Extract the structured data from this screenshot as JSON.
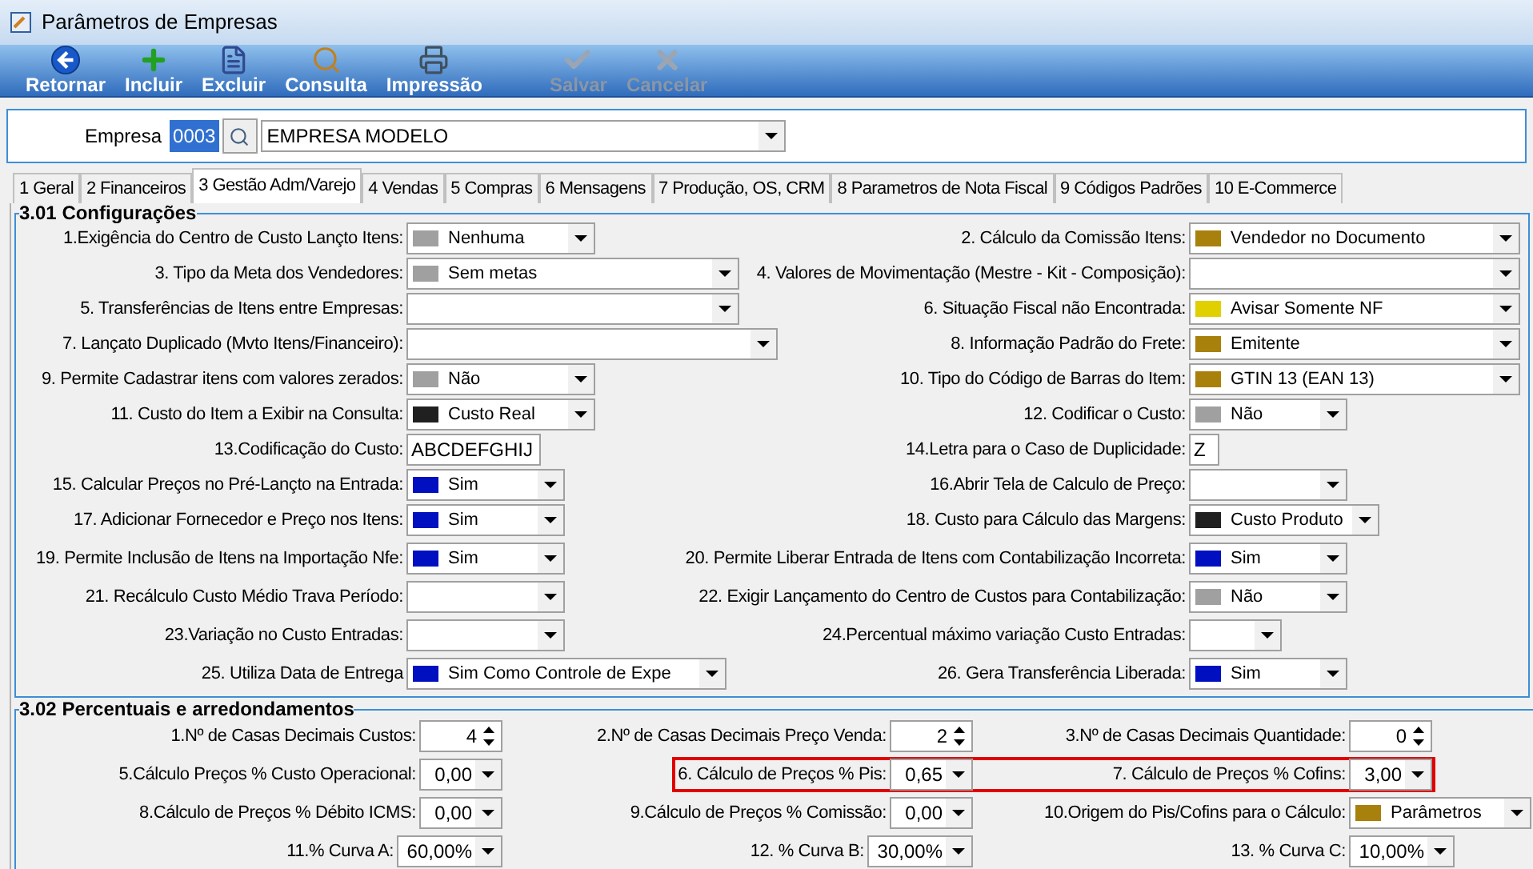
{
  "window": {
    "title": "Parâmetros de Empresas"
  },
  "toolbar": [
    {
      "kind": "back",
      "label": "Retornar",
      "disabled": false
    },
    {
      "kind": "add",
      "label": "Incluir",
      "disabled": false
    },
    {
      "kind": "delete",
      "label": "Excluir",
      "disabled": false
    },
    {
      "kind": "search",
      "label": "Consulta",
      "disabled": false
    },
    {
      "kind": "print",
      "label": "Impressão",
      "disabled": false
    },
    {
      "kind": "save",
      "label": "Salvar",
      "disabled": true
    },
    {
      "kind": "cancel",
      "label": "Cancelar",
      "disabled": true
    }
  ],
  "company": {
    "label": "Empresa",
    "code": "0003",
    "name": "EMPRESA MODELO"
  },
  "tabs": [
    {
      "label": "1 Geral",
      "selected": false
    },
    {
      "label": "2 Financeiros",
      "selected": false
    },
    {
      "label": "3 Gestão Adm/Varejo",
      "selected": true
    },
    {
      "label": "4 Vendas",
      "selected": false
    },
    {
      "label": "5 Compras",
      "selected": false
    },
    {
      "label": "6 Mensagens",
      "selected": false
    },
    {
      "label": "7 Produção, OS, CRM",
      "selected": false
    },
    {
      "label": "8 Parametros de Nota Fiscal",
      "selected": false
    },
    {
      "label": "9 Códigos Padrões",
      "selected": false
    },
    {
      "label": "10 E-Commerce",
      "selected": false
    }
  ],
  "config": {
    "title": "3.01 Configurações",
    "rows": [
      {
        "left": {
          "label": "1.Exigência do Centro de Custo Lançto Itens:",
          "kind": "select",
          "value": "Nenhuma",
          "color": "#a0a0a0"
        },
        "right": {
          "label": "2. Cálculo da Comissão Itens:",
          "kind": "select",
          "value": "Vendedor no Documento",
          "color": "#a8800c"
        }
      },
      {
        "left": {
          "label": "3. Tipo da Meta dos Vendedores:",
          "kind": "select",
          "value": "Sem metas",
          "color": "#a0a0a0"
        },
        "right": {
          "label": "4. Valores de Movimentação (Mestre - Kit - Composição):",
          "kind": "select"
        }
      },
      {
        "left": {
          "label": "5. Transferências  de Itens entre Empresas:",
          "kind": "select"
        },
        "right": {
          "label": "6. Situação Fiscal não Encontrada:",
          "kind": "select",
          "value": "Avisar Somente NF",
          "color": "#e0d000"
        }
      },
      {
        "left": {
          "label": "7. Lançato Duplicado (Mvto Itens/Financeiro):",
          "kind": "select"
        },
        "right": {
          "label": "8. Informação Padrão do Frete:",
          "kind": "select",
          "value": "Emitente",
          "color": "#a8800c"
        }
      },
      {
        "left": {
          "label": "9. Permite Cadastrar itens com valores zerados:",
          "kind": "select",
          "value": "Não",
          "color": "#a0a0a0"
        },
        "right": {
          "label": "10. Tipo do Código de Barras do Item:",
          "kind": "select",
          "value": "GTIN 13 (EAN 13)",
          "color": "#a8800c"
        }
      },
      {
        "left": {
          "label": "11. Custo do Item a Exibir na Consulta:",
          "kind": "select",
          "value": "Custo Real",
          "color": "#202020"
        },
        "right": {
          "label": "12. Codificar o Custo:",
          "kind": "select",
          "value": "Não",
          "color": "#a0a0a0"
        }
      },
      {
        "left": {
          "label": "13.Codificação do Custo:",
          "kind": "text",
          "value": "ABCDEFGHIJ"
        },
        "right": {
          "label": "14.Letra para o Caso de Duplicidade:",
          "kind": "text",
          "value": "Z"
        }
      },
      {
        "left": {
          "label": "15. Calcular Preços no Pré-Lançto na Entrada:",
          "kind": "select",
          "value": "Sim",
          "color": "#0010c0"
        },
        "right": {
          "label": "16.Abrir Tela de Calculo de Preço:",
          "kind": "select"
        }
      },
      {
        "left": {
          "label": "17. Adicionar Fornecedor e Preço nos Itens:",
          "kind": "select",
          "value": "Sim",
          "color": "#0010c0"
        },
        "right": {
          "label": "18. Custo para Cálculo das Margens:",
          "kind": "select",
          "value": "Custo Produto",
          "color": "#202020"
        }
      },
      {
        "left": {
          "label": "19. Permite Inclusão de Itens na Importação Nfe:",
          "kind": "select",
          "value": "Sim",
          "color": "#0010c0"
        },
        "right": {
          "label": "20. Permite Liberar Entrada de Itens com Contabilização Incorreta:",
          "kind": "select",
          "value": "Sim",
          "color": "#0010c0"
        }
      },
      {
        "left": {
          "label": "21. Recálculo Custo Médio Trava Período:",
          "kind": "select"
        },
        "right": {
          "label": "22. Exigir Lançamento do Centro de Custos para Contabilização:",
          "kind": "select",
          "value": "Não",
          "color": "#a0a0a0"
        }
      },
      {
        "left": {
          "label": "23.Variação no Custo Entradas:",
          "kind": "select"
        },
        "right": {
          "label": "24.Percentual máximo variação Custo Entradas:",
          "kind": "select"
        }
      },
      {
        "left": {
          "label": "25. Utiliza Data de Entrega",
          "kind": "select",
          "value": "Sim Como Controle de Expe",
          "color": "#0010c0"
        },
        "right": {
          "label": "26. Gera Transferência Liberada:",
          "kind": "select",
          "value": "Sim",
          "color": "#0010c0"
        }
      }
    ]
  },
  "percent": {
    "title": "3.02 Percentuais e arredondamentos",
    "rows": [
      [
        {
          "label": "1.Nº de Casas Decimais Custos:",
          "kind": "spin",
          "value": "4",
          "highlighted": false
        },
        {
          "label": "2.Nº de Casas Decimais Preço Venda:",
          "kind": "spin",
          "value": "2",
          "highlighted": false
        },
        {
          "label": "3.Nº de Casas Decimais Quantidade:",
          "kind": "spin",
          "value": "0",
          "highlighted": false
        }
      ],
      [
        {
          "label": "5.Cálculo Preços % Custo Operacional:",
          "kind": "dropdown",
          "value": "0,00",
          "highlighted": false
        },
        {
          "label": "6. Cálculo de Preços % Pis:",
          "kind": "dropdown",
          "value": "0,65",
          "highlighted": true
        },
        {
          "label": "7. Cálculo de Preços % Cofins:",
          "kind": "dropdown",
          "value": "3,00",
          "highlighted": true
        }
      ],
      [
        {
          "label": "8.Cálculo de Preços % Débito ICMS:",
          "kind": "dropdown",
          "value": "0,00",
          "highlighted": false
        },
        {
          "label": "9.Cálculo de Preços % Comissão:",
          "kind": "dropdown",
          "value": "0,00",
          "highlighted": false
        },
        {
          "label": "10.Origem do Pis/Cofins para o Cálculo:",
          "kind": "select",
          "value": "Parâmetros",
          "color": "#a8800c",
          "highlighted": false
        }
      ],
      [
        {
          "label": "11.% Curva A:",
          "kind": "dropdown",
          "value": "60,00%",
          "highlighted": false
        },
        {
          "label": "12. % Curva B:",
          "kind": "dropdown",
          "value": "30,00%",
          "highlighted": false
        },
        {
          "label": "13. % Curva C:",
          "kind": "dropdown",
          "value": "10,00%",
          "highlighted": false
        }
      ]
    ]
  }
}
